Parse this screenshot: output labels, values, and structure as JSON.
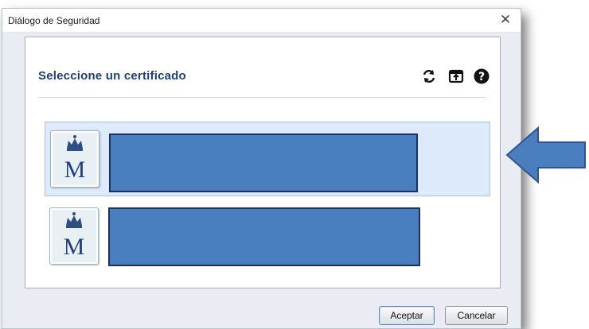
{
  "dialog": {
    "title": "Diálogo de Seguridad",
    "close_icon": "close-icon"
  },
  "panel": {
    "header": "Seleccione un certificado",
    "toolbar": [
      {
        "name": "refresh-icon"
      },
      {
        "name": "import-icon"
      },
      {
        "name": "help-icon"
      }
    ]
  },
  "certificates": [
    {
      "icon": "royal-crown-m-logo",
      "selected": true,
      "redacted": true
    },
    {
      "icon": "royal-crown-m-logo",
      "selected": false,
      "redacted": true
    }
  ],
  "buttons": {
    "ok_label": "Aceptar",
    "cancel_label": "Cancelar"
  },
  "colors": {
    "header_text": "#1d3f7a",
    "selected_row": "#ddeafb",
    "redaction": "#4a7fbf",
    "arrow": "#4a7fbf"
  }
}
